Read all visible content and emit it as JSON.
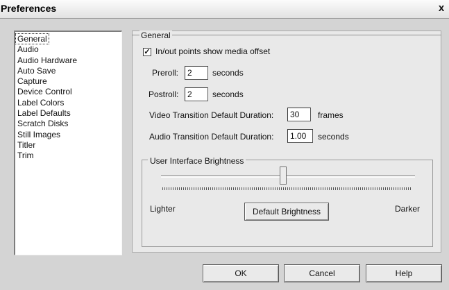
{
  "window": {
    "title": "Preferences",
    "close_glyph": "x"
  },
  "sidebar": {
    "items": [
      {
        "label": "General",
        "selected": true
      },
      {
        "label": "Audio"
      },
      {
        "label": "Audio Hardware"
      },
      {
        "label": "Auto Save"
      },
      {
        "label": "Capture"
      },
      {
        "label": "Device Control"
      },
      {
        "label": "Label Colors"
      },
      {
        "label": "Label Defaults"
      },
      {
        "label": "Scratch Disks"
      },
      {
        "label": "Still Images"
      },
      {
        "label": "Titler"
      },
      {
        "label": "Trim"
      }
    ]
  },
  "general": {
    "group_label": "General",
    "media_offset": {
      "label": "In/out points show media offset",
      "checked": true
    },
    "preroll": {
      "label": "Preroll:",
      "value": "2",
      "unit": "seconds"
    },
    "postroll": {
      "label": "Postroll:",
      "value": "2",
      "unit": "seconds"
    },
    "video_transition": {
      "label": "Video Transition Default Duration:",
      "value": "30",
      "unit": "frames"
    },
    "audio_transition": {
      "label": "Audio Transition Default Duration:",
      "value": "1.00",
      "unit": "seconds"
    }
  },
  "brightness": {
    "group_label": "User Interface Brightness",
    "lighter_label": "Lighter",
    "darker_label": "Darker",
    "default_button": "Default Brightness",
    "level_fraction": 0.48
  },
  "footer": {
    "ok": "OK",
    "cancel": "Cancel",
    "help": "Help"
  }
}
